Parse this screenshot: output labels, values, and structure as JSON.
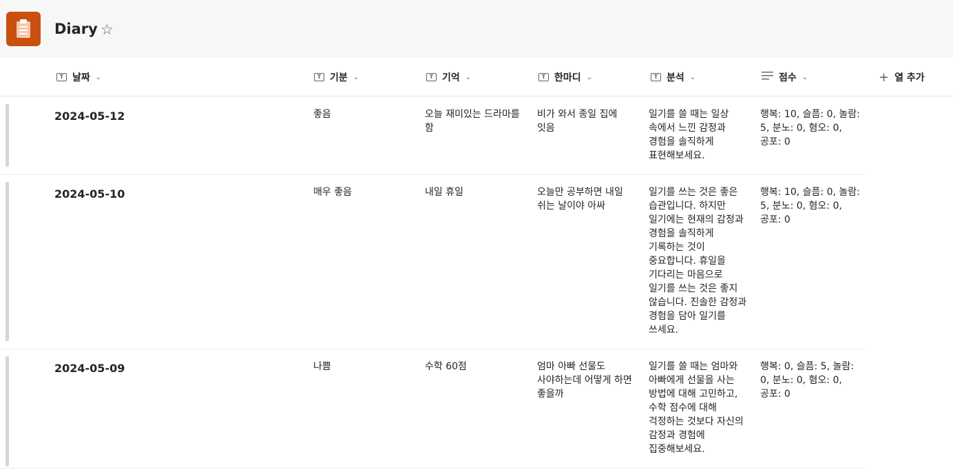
{
  "app": {
    "title": "Diary",
    "accent_color": "#ca5010",
    "icon": "clipboard-icon",
    "favorite_icon": "star-icon"
  },
  "columns": [
    {
      "label": "날짜",
      "type_icon": "text-icon"
    },
    {
      "label": "기분",
      "type_icon": "text-icon"
    },
    {
      "label": "기억",
      "type_icon": "text-icon"
    },
    {
      "label": "한마디",
      "type_icon": "text-icon"
    },
    {
      "label": "분석",
      "type_icon": "text-icon"
    },
    {
      "label": "점수",
      "type_icon": "multiline-text-icon"
    }
  ],
  "add_column_label": "열 추가",
  "rows": [
    {
      "date": "2024-05-12",
      "mood": "좋음",
      "memory": "오늘 재미있는 드라마를 함",
      "comment": "비가 와서 종일 집에 잇음",
      "analysis": "일기를 쓸 때는 일상 속에서 느낀 감정과 경험을 솔직하게 표현해보세요.",
      "score": "행복: 10, 슬픔: 0, 놀람: 5, 분노: 0, 혐오: 0, 공포: 0"
    },
    {
      "date": "2024-05-10",
      "mood": "매우 좋음",
      "memory": "내일 휴일",
      "comment": "오늘만 공부하면 내일 쉬는 날이야 아싸",
      "analysis": "일기를 쓰는 것은 좋은 습관입니다. 하지만 일기에는 현재의 감정과 경험을 솔직하게 기록하는 것이 중요합니다. 휴일을 기다리는 마음으로 일기를 쓰는 것은 좋지 않습니다. 진솔한 감정과 경험을 담아 일기를 쓰세요.",
      "score": "행복: 10, 슬픔: 0, 놀람: 5, 분노: 0, 혐오: 0, 공포: 0"
    },
    {
      "date": "2024-05-09",
      "mood": "나쁨",
      "memory": "수학 60점",
      "comment": "엄마 아빠 선물도 사야하는데 어떻게 하면 좋을까",
      "analysis": "일기를 쓸 때는 엄마와 아빠에게 선물을 사는 방법에 대해 고민하고, 수학 점수에 대해 걱정하는 것보다 자신의 감정과 경험에 집중해보세요.",
      "score": "행복: 0, 슬픔: 5, 놀람: 0, 분노: 0, 혐오: 0, 공포: 0"
    }
  ]
}
